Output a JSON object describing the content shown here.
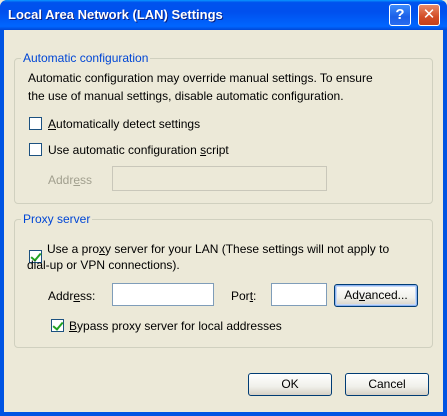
{
  "window": {
    "title": "Local Area Network (LAN) Settings",
    "help_glyph": "?",
    "close_glyph": "✕"
  },
  "auto_config": {
    "legend": "Automatic configuration",
    "description_line1": "Automatic configuration may override manual settings.  To ensure",
    "description_line2": "the use of manual settings, disable automatic configuration.",
    "auto_detect": {
      "pre": "",
      "key": "A",
      "post": "utomatically detect settings",
      "checked": false
    },
    "use_script": {
      "pre": "Use automatic configuration ",
      "key": "s",
      "post": "cript",
      "checked": false
    },
    "address_label": {
      "pre": "Addr",
      "key": "e",
      "post": "ss"
    },
    "address_value": ""
  },
  "proxy": {
    "legend": "Proxy server",
    "use_proxy_line1": {
      "pre": "Use a pro",
      "key": "x",
      "post": "y server for your LAN (These settings will not apply to"
    },
    "use_proxy_line2": "dial-up or VPN connections).",
    "use_proxy_checked": true,
    "address_label": {
      "pre": "Addr",
      "key": "e",
      "post": "ss:"
    },
    "address_value": "",
    "port_label": {
      "pre": "Por",
      "key": "t",
      "post": ":"
    },
    "port_value": "",
    "advanced": {
      "pre": "Ad",
      "key": "v",
      "post": "anced..."
    },
    "bypass": {
      "pre": "",
      "key": "B",
      "post": "ypass proxy server for local addresses",
      "checked": true
    }
  },
  "buttons": {
    "ok": "OK",
    "cancel": "Cancel"
  }
}
